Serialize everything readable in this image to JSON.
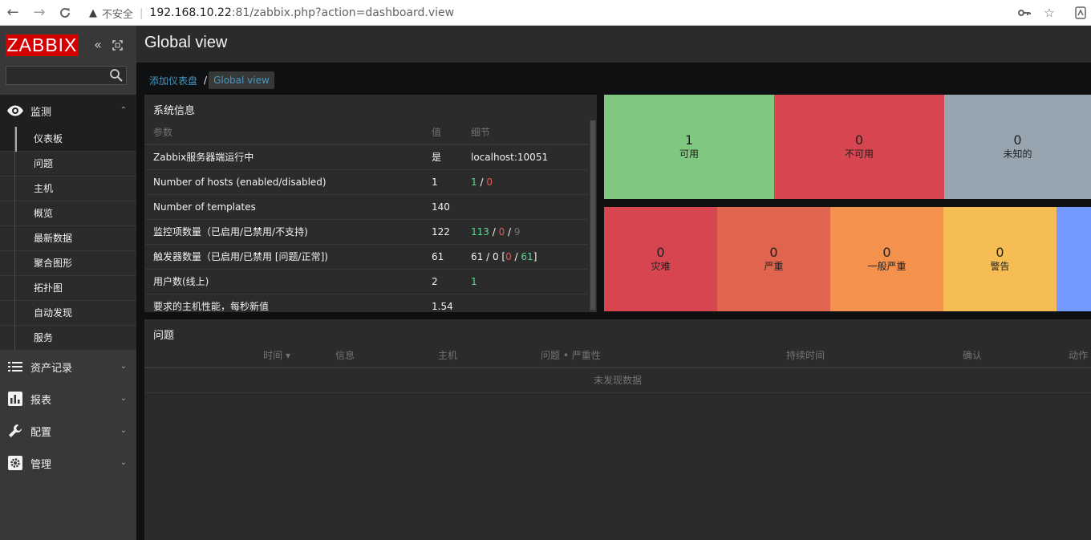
{
  "browser": {
    "security_label": "不安全",
    "url_host": "192.168.10.22",
    "url_path": ":81/zabbix.php?action=dashboard.view"
  },
  "sidebar": {
    "logo": "ZABBIX",
    "search_value": "",
    "monitoring": {
      "label": "监测",
      "items": [
        "仪表板",
        "问题",
        "主机",
        "概览",
        "最新数据",
        "聚合图形",
        "拓扑图",
        "自动发现",
        "服务"
      ]
    },
    "sections": [
      {
        "label": "资产记录",
        "icon": "list-icon"
      },
      {
        "label": "报表",
        "icon": "report-icon"
      },
      {
        "label": "配置",
        "icon": "wrench-icon"
      },
      {
        "label": "管理",
        "icon": "gear-icon"
      }
    ]
  },
  "header": {
    "title": "Global view"
  },
  "breadcrumbs": {
    "parent": "添加仪表盘",
    "separator": "/",
    "current": "Global view"
  },
  "system_info": {
    "title": "系统信息",
    "columns": [
      "参数",
      "值",
      "细节"
    ],
    "rows": [
      {
        "param": "Zabbix服务器端运行中",
        "value": "是",
        "detail": "localhost:10051"
      },
      {
        "param": "Number of hosts (enabled/disabled)",
        "value": "1",
        "d1": "1",
        "d2": "0"
      },
      {
        "param": "Number of templates",
        "value": "140"
      },
      {
        "param": "监控项数量（已启用/已禁用/不支持)",
        "value": "122",
        "d1": "113",
        "d2": "0",
        "d3": "9"
      },
      {
        "param": "触发器数量（已启用/已禁用 [问题/正常])",
        "value": "61",
        "d1": "61",
        "d2": "0",
        "d3": "0",
        "d4": "61"
      },
      {
        "param": "用户数(线上)",
        "value": "2",
        "d1": "1"
      },
      {
        "param": "要求的主机性能，每秒新值",
        "value": "1.54"
      }
    ]
  },
  "host_availability": [
    {
      "count": "1",
      "label": "可用",
      "color": "#80c880"
    },
    {
      "count": "0",
      "label": "不可用",
      "color": "#d64550"
    },
    {
      "count": "0",
      "label": "未知的",
      "color": "#97a5b0"
    }
  ],
  "problems_by_severity": [
    {
      "count": "0",
      "label": "灾难",
      "color": "#d64550"
    },
    {
      "count": "0",
      "label": "严重",
      "color": "#e0654f"
    },
    {
      "count": "0",
      "label": "一般严重",
      "color": "#f4914c"
    },
    {
      "count": "0",
      "label": "警告",
      "color": "#f7bd55"
    },
    {
      "color": "#7499ff"
    }
  ],
  "problems": {
    "title": "问题",
    "columns": [
      "时间 ▾",
      "信息",
      "主机",
      "问题 • 严重性",
      "持续时间",
      "确认",
      "动作"
    ],
    "empty": "未发现数据"
  }
}
